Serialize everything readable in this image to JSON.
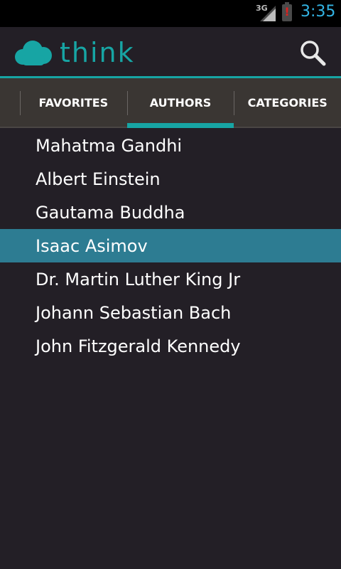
{
  "status_bar": {
    "network": "3G",
    "battery_alert": "!",
    "time": "3:35"
  },
  "header": {
    "logo_text": "think",
    "logo_icon": "cloud-icon",
    "search_icon": "search-icon",
    "accent_color": "#17a5a4"
  },
  "tabs": [
    {
      "label": "FAVORITES",
      "active": false
    },
    {
      "label": "AUTHORS",
      "active": true
    },
    {
      "label": "CATEGORIES",
      "active": false
    }
  ],
  "authors": [
    {
      "name": "Mahatma Gandhi",
      "selected": false
    },
    {
      "name": "Albert Einstein",
      "selected": false
    },
    {
      "name": "Gautama Buddha",
      "selected": false
    },
    {
      "name": "Isaac Asimov",
      "selected": true
    },
    {
      "name": "Dr. Martin Luther King Jr",
      "selected": false
    },
    {
      "name": "Johann Sebastian Bach",
      "selected": false
    },
    {
      "name": "John Fitzgerald Kennedy",
      "selected": false
    }
  ],
  "colors": {
    "background": "#231f26",
    "selected_row": "#2d7c92",
    "tab_bar": "#3a3633",
    "clock": "#33b5e5"
  }
}
